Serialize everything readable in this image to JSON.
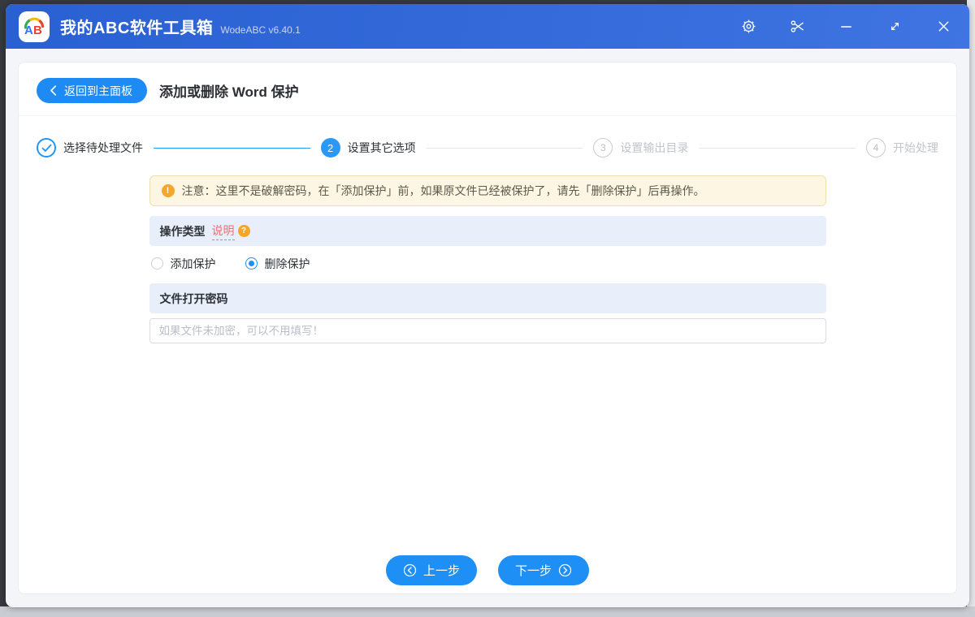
{
  "titlebar": {
    "app_title": "我的ABC软件工具箱",
    "version": "WodeABC v6.40.1",
    "app_icon_text": "AB"
  },
  "header": {
    "back_label": "返回到主面板",
    "title": "添加或删除 Word 保护"
  },
  "stepper": {
    "steps": [
      {
        "num": "1",
        "label": "选择待处理文件",
        "state": "done"
      },
      {
        "num": "2",
        "label": "设置其它选项",
        "state": "active"
      },
      {
        "num": "3",
        "label": "设置输出目录",
        "state": "pending"
      },
      {
        "num": "4",
        "label": "开始处理",
        "state": "pending"
      }
    ]
  },
  "notice": {
    "text": "注意：这里不是破解密码，在「添加保护」前，如果原文件已经被保护了，请先「删除保护」后再操作。",
    "icon_glyph": "!"
  },
  "operation_type": {
    "title": "操作类型",
    "help_label": "说明",
    "help_badge_glyph": "?",
    "options": [
      {
        "label": "添加保护",
        "selected": false
      },
      {
        "label": "删除保护",
        "selected": true
      }
    ]
  },
  "open_password": {
    "title": "文件打开密码",
    "value": "",
    "placeholder": "如果文件未加密，可以不用填写！"
  },
  "footer": {
    "prev_label": "上一步",
    "next_label": "下一步"
  },
  "icons": {
    "titlebar": [
      "settings-gear-icon",
      "scissors-icon",
      "minimize-icon",
      "resize-icon",
      "close-icon"
    ],
    "back_button": "chevron-left-icon",
    "step_done": "check-icon",
    "notice": "warning-icon",
    "help": "question-icon",
    "footer": [
      "circle-chevron-left-icon",
      "circle-chevron-right-icon"
    ]
  },
  "colors": {
    "accent_blue": "#1e90f5",
    "titlebar_blue_dark": "#2a61d2",
    "titlebar_blue_light": "#3f74e2",
    "step_active_blue": "#2b98f5",
    "notice_bg": "#fdf6e3",
    "notice_border": "#f1e0a8",
    "warning_orange": "#f3a72c",
    "help_red": "#f56c6c",
    "section_header_bg": "#e9eefb",
    "inactive_gray": "#c0c4cc"
  }
}
